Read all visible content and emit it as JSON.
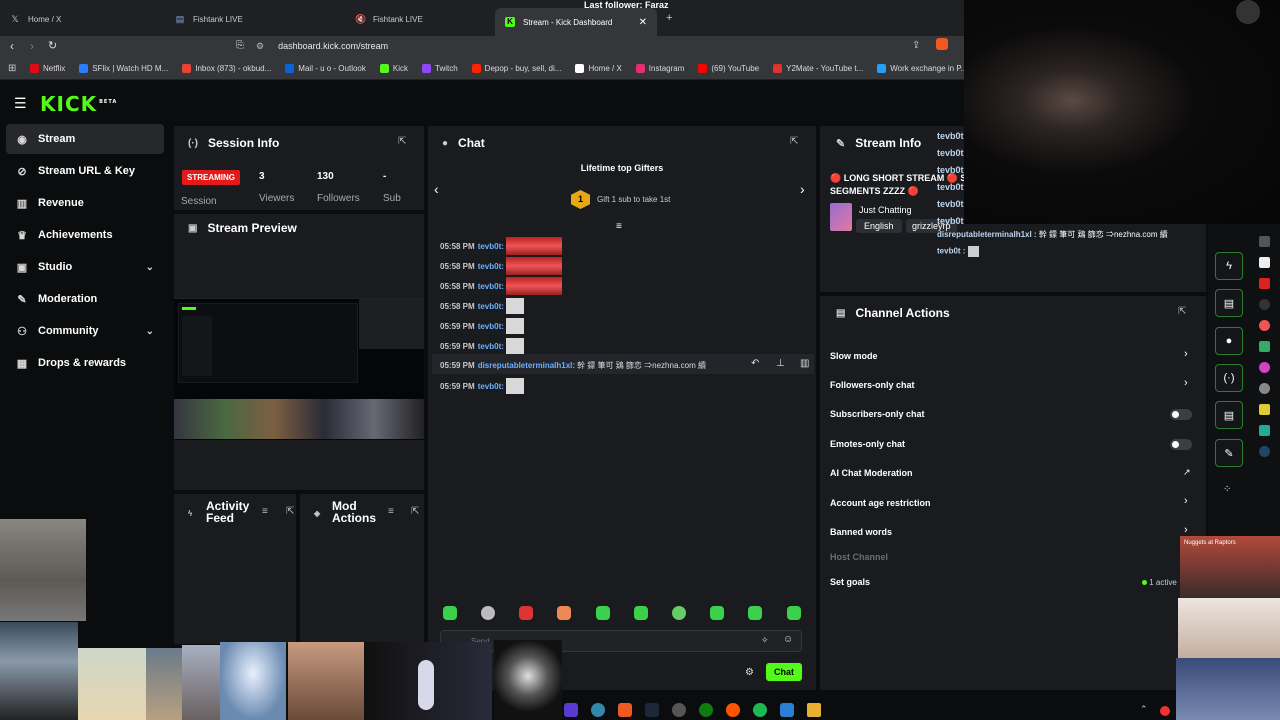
{
  "browser": {
    "tabs": [
      {
        "label": "Home / X",
        "icon": "x-icon"
      },
      {
        "label": "Fishtank LIVE",
        "icon": "fish-icon"
      },
      {
        "label": "Fishtank LIVE",
        "icon": "mute-icon"
      },
      {
        "label": "Stream - Kick Dashboard",
        "icon": "kick-icon"
      }
    ],
    "window_title": "Last follower: Faraz",
    "url": "dashboard.kick.com/stream",
    "bookmarks": [
      {
        "label": "Netflix",
        "color": "#e50914"
      },
      {
        "label": "SFlix | Watch HD M...",
        "color": "#2b7fff"
      },
      {
        "label": "Inbox (873) - okbud...",
        "color": "#ea4335"
      },
      {
        "label": "Mail - u o - Outlook",
        "color": "#0a64d8"
      },
      {
        "label": "Kick",
        "color": "#53fc18"
      },
      {
        "label": "Twitch",
        "color": "#9146ff"
      },
      {
        "label": "Depop - buy, sell, di...",
        "color": "#ff2300"
      },
      {
        "label": "Home / X",
        "color": "#ffffff"
      },
      {
        "label": "Instagram",
        "color": "#e1306c"
      },
      {
        "label": "(69) YouTube",
        "color": "#ff0000"
      },
      {
        "label": "Y2Mate - YouTube t...",
        "color": "#d33"
      },
      {
        "label": "Work exchange in P...",
        "color": "#2a9df4"
      }
    ]
  },
  "brand": {
    "logo": "KICK",
    "beta": "BETA",
    "accent": "#53fc18"
  },
  "sidebar": {
    "items": [
      {
        "label": "Stream",
        "icon": "broadcast-icon"
      },
      {
        "label": "Stream URL & Key",
        "icon": "link-icon"
      },
      {
        "label": "Revenue",
        "icon": "chart-icon"
      },
      {
        "label": "Achievements",
        "icon": "trophy-icon"
      },
      {
        "label": "Studio",
        "icon": "studio-icon"
      },
      {
        "label": "Moderation",
        "icon": "wrench-icon"
      },
      {
        "label": "Community",
        "icon": "community-icon"
      },
      {
        "label": "Drops & rewards",
        "icon": "gift-icon"
      }
    ]
  },
  "session": {
    "title": "Session Info",
    "status": "STREAMING",
    "status_sub": "Session",
    "viewers": "3",
    "viewers_label": "Viewers",
    "followers": "130",
    "followers_label": "Followers",
    "subs": "-",
    "subs_label": "Sub"
  },
  "preview": {
    "title": "Stream Preview"
  },
  "activity": {
    "title_1": "Activity",
    "title_2": "Feed"
  },
  "mod": {
    "title_1": "Mod",
    "title_2": "Actions"
  },
  "chat": {
    "title": "Chat",
    "gifters_title": "Lifetime top Gifters",
    "gifter_rank": "1",
    "gifter_cta": "Gift 1 sub to take 1st",
    "messages": [
      {
        "time": "05:58 PM",
        "user": "tevb0t:",
        "body": ""
      },
      {
        "time": "05:58 PM",
        "user": "tevb0t:",
        "body": ""
      },
      {
        "time": "05:58 PM",
        "user": "tevb0t:",
        "body": ""
      },
      {
        "time": "05:58 PM",
        "user": "tevb0t:",
        "body": ""
      },
      {
        "time": "05:59 PM",
        "user": "tevb0t:",
        "body": ""
      },
      {
        "time": "05:59 PM",
        "user": "tevb0t:",
        "body": ""
      },
      {
        "time": "05:59 PM",
        "user": "disreputableterminalh1xl:",
        "body": "幹 鏢 筆可 鶏 篩恋 ⇒nezhna.com 續"
      },
      {
        "time": "05:59 PM",
        "user": "tevb0t:",
        "body": ""
      }
    ],
    "input_placeholder": "Send",
    "send_label": "Chat"
  },
  "stream_info": {
    "title": "Stream Info",
    "stream_title": "🔴 LONG SHORT STREAM 🔴 S SEGMENTS ZZZZ 🔴",
    "category": "Just Chatting",
    "tags": [
      "English",
      "grizzleyrp"
    ]
  },
  "overlay_chat": {
    "names": [
      "tevb0t",
      "tevb0t",
      "tevb0t",
      "tevb0t",
      "tevb0t",
      "tevb0t"
    ],
    "message_user": "disreputableterminalh1xl :",
    "message_body": "幹 鏢 筆可 鶏 篩恋 ⇒nezhna.com 續",
    "last_user": "tevb0t :"
  },
  "channel_actions": {
    "title": "Channel Actions",
    "items": [
      {
        "label": "Slow mode",
        "control": "chevron"
      },
      {
        "label": "Followers-only chat",
        "control": "chevron"
      },
      {
        "label": "Subscribers-only chat",
        "control": "toggle"
      },
      {
        "label": "Emotes-only chat",
        "control": "toggle"
      },
      {
        "label": "AI Chat Moderation",
        "control": "external"
      },
      {
        "label": "Account age restriction",
        "control": "chevron"
      },
      {
        "label": "Banned words",
        "control": "chevron"
      },
      {
        "label": "Host Channel",
        "control": "none"
      },
      {
        "label": "Set goals",
        "control": "status"
      }
    ],
    "goals_status": "1 active"
  },
  "overlay_badge": {
    "label": "Nuggets at Raptors"
  }
}
